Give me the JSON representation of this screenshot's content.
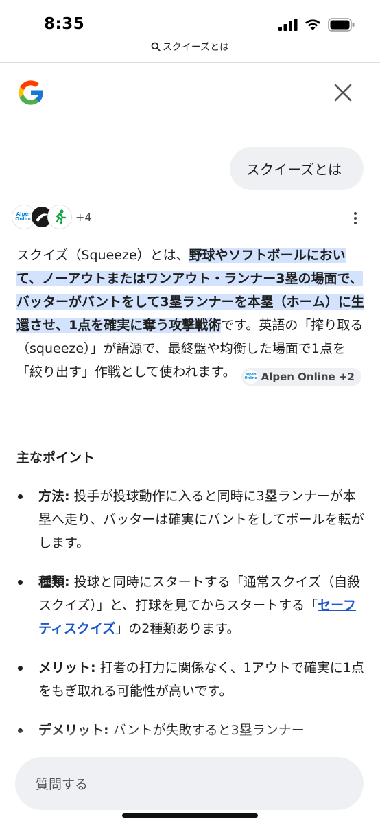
{
  "status_bar": {
    "time": "8:35"
  },
  "browser": {
    "url_text": "スクイーズとは"
  },
  "query": "スクイーズとは",
  "sources": {
    "more": "+4",
    "alpen_logo_text": "Alpen Online"
  },
  "answer": {
    "intro": "スクイズ（Squeeze）とは、",
    "highlight": "野球やソフトボールにおいて、ノーアウトまたはワンアウト・ランナー3塁の場面で、バッターがバントをして3塁ランナーを本塁（ホーム）に生還させ、1点を確実に奪う攻撃戦術",
    "rest": "です。英語の「搾り取る（squeeze）」が語源で、最終盤や均衡した場面で1点を「絞り出す」作戦として使われます。",
    "chip": "Alpen Online +2"
  },
  "section_title": "主なポイント",
  "points": [
    {
      "label": "方法:",
      "text": " 投手が投球動作に入ると同時に3塁ランナーが本塁へ走り、バッターは確実にバントをしてボールを転がします。"
    },
    {
      "label": "種類:",
      "text_before": " 投球と同時にスタートする「通常スクイズ（自殺スクイズ）」と、打球を見てからスタートする「",
      "link": "セーフティスクイズ",
      "text_after": "」の2種類あります。"
    },
    {
      "label": "メリット:",
      "text": " 打者の打力に関係なく、1アウトで確実に1点をもぎ取れる可能性が高いです。"
    },
    {
      "label": "デメリット:",
      "text": " バントが失敗すると3塁ランナー"
    }
  ],
  "ask_placeholder": "質問する",
  "colors": {
    "highlight": "#d3e3fd",
    "link": "#1a57c9",
    "bubble": "#eef0f4"
  }
}
